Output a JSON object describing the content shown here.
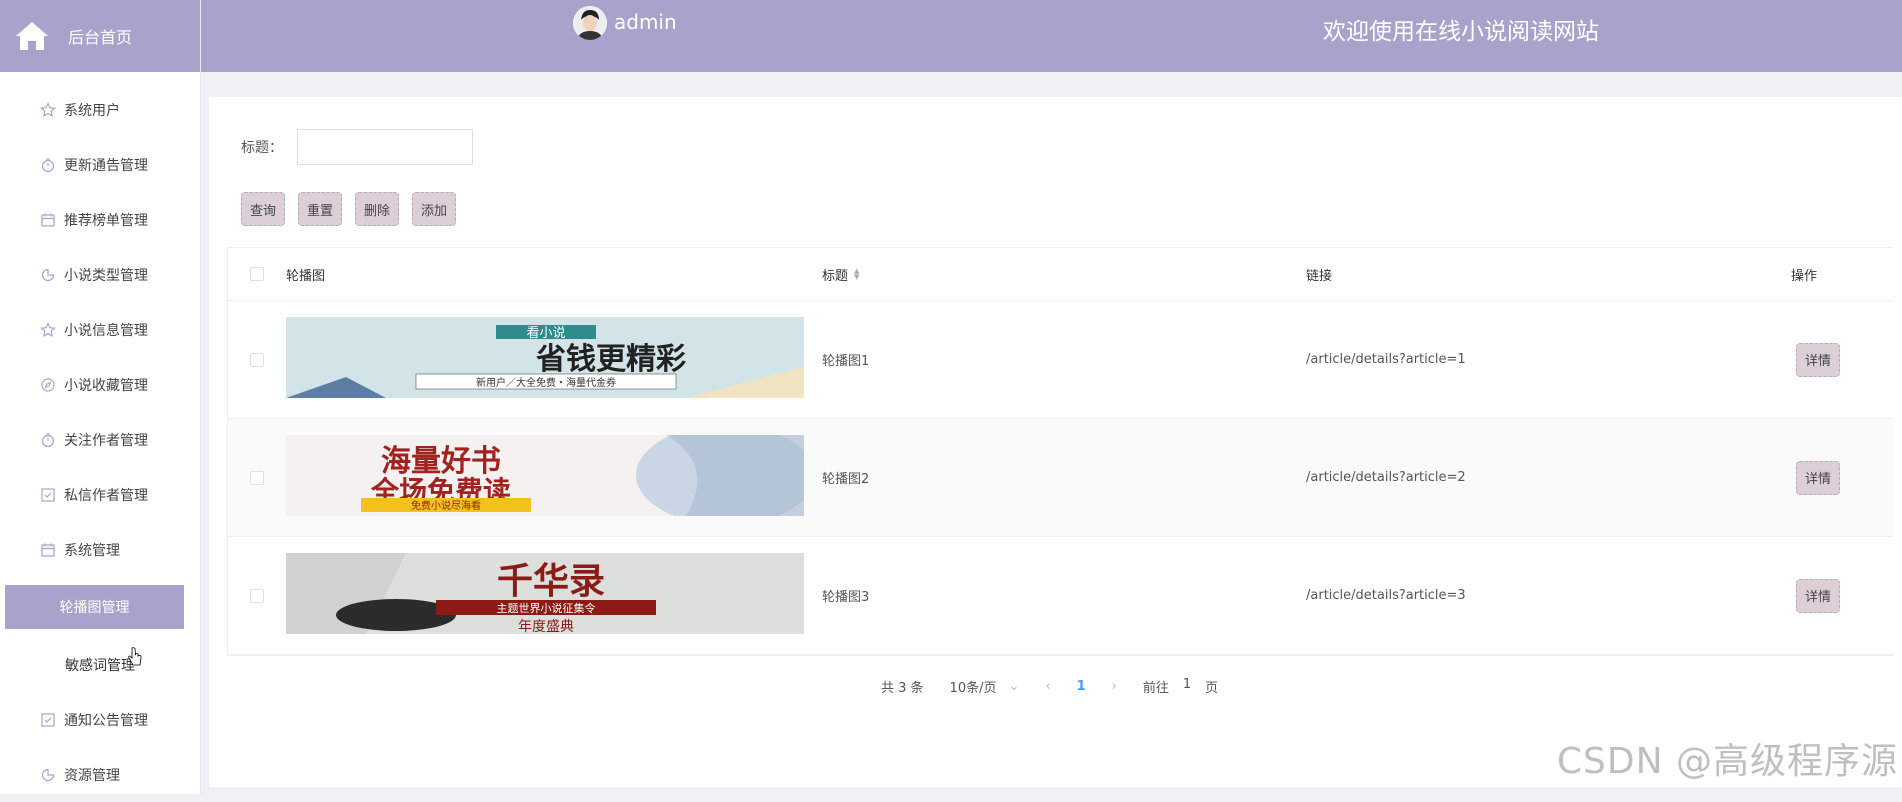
{
  "sidebar": {
    "header_title": "后台首页",
    "items": [
      {
        "label": "系统用户",
        "icon": "star-icon"
      },
      {
        "label": "更新通告管理",
        "icon": "timer-icon"
      },
      {
        "label": "推荐榜单管理",
        "icon": "calendar-icon"
      },
      {
        "label": "小说类型管理",
        "icon": "pie-icon"
      },
      {
        "label": "小说信息管理",
        "icon": "star-icon"
      },
      {
        "label": "小说收藏管理",
        "icon": "compass-icon"
      },
      {
        "label": "关注作者管理",
        "icon": "timer-icon"
      },
      {
        "label": "私信作者管理",
        "icon": "checkbox-icon"
      },
      {
        "label": "系统管理",
        "icon": "calendar-icon"
      },
      {
        "label": "轮播图管理",
        "icon": ""
      },
      {
        "label": "敏感词管理",
        "icon": ""
      },
      {
        "label": "通知公告管理",
        "icon": "checkbox-icon"
      },
      {
        "label": "资源管理",
        "icon": "pie-icon"
      }
    ]
  },
  "topbar": {
    "username": "admin",
    "welcome": "欢迎使用在线小说阅读网站"
  },
  "search": {
    "label": "标题：",
    "value": "",
    "placeholder": ""
  },
  "buttons": {
    "query": "查询",
    "reset": "重置",
    "delete": "删除",
    "add": "添加"
  },
  "table": {
    "headers": {
      "image": "轮播图",
      "title": "标题",
      "link": "链接",
      "action": "操作"
    },
    "rows": [
      {
        "title": "轮播图1",
        "link": "/article/details?article=1",
        "action": "详情",
        "banner": {
          "top": "看小说",
          "main": "省钱更精彩",
          "sub": "新用户／大全免费・海量代金券"
        }
      },
      {
        "title": "轮播图2",
        "link": "/article/details?article=2",
        "action": "详情",
        "banner": {
          "line1": "海量好书",
          "line2": "全场免费读",
          "sub": "免费小说尽海看"
        }
      },
      {
        "title": "轮播图3",
        "link": "/article/details?article=3",
        "action": "详情",
        "banner": {
          "main": "千华录",
          "sub": "主题世界小说征集令",
          "bottom": "年度盛典"
        }
      }
    ]
  },
  "pagination": {
    "total": "共 3 条",
    "page_size": "10条/页",
    "current": "1",
    "goto_label": "前往",
    "goto_value": "1",
    "page_suffix": "页"
  },
  "watermark": "CSDN @高级程序源",
  "colors": {
    "primary": "#a9a3cc",
    "button_bg": "#dccfd6",
    "active_page": "#409eff"
  }
}
